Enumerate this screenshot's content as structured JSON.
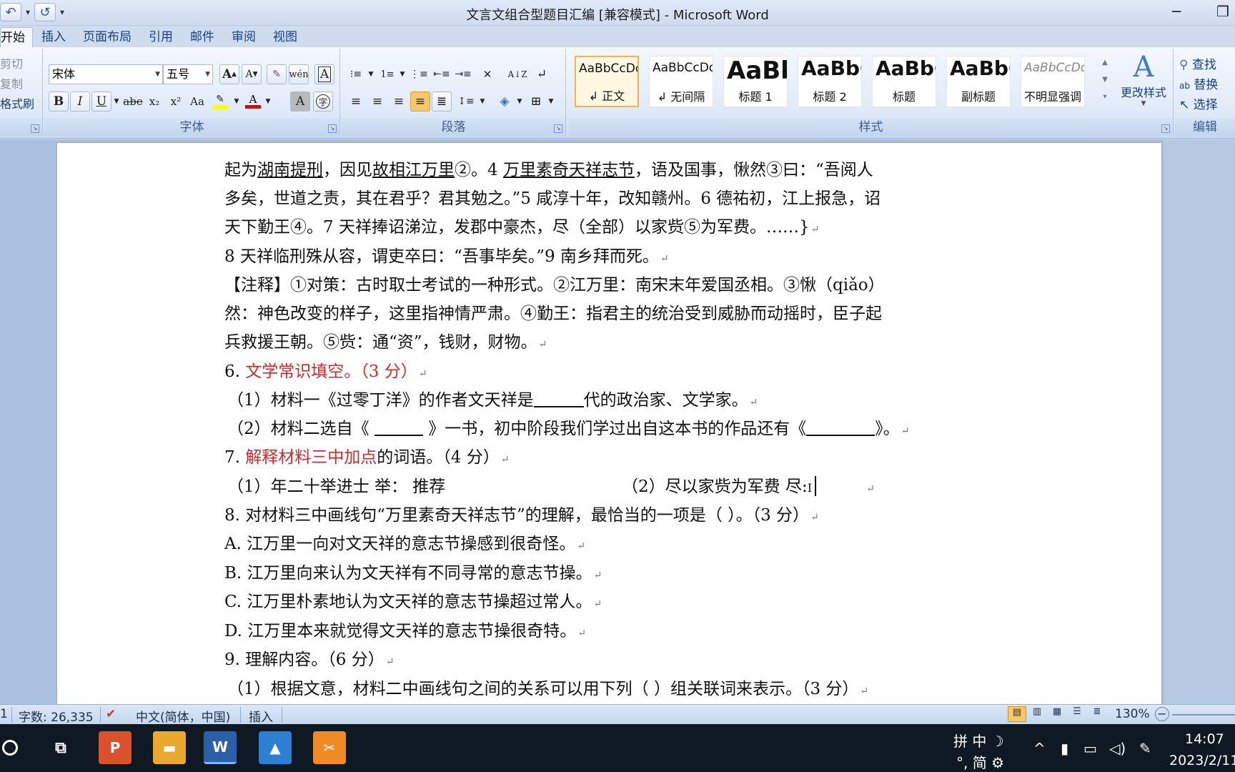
{
  "window": {
    "title": "文言文组合型题目汇编 [兼容模式] - Microsoft Word",
    "minimize": "─",
    "restore": "❐"
  },
  "qat": {
    "undo": "↶",
    "redo": "↺",
    "more": "▾"
  },
  "tabs": [
    "开始",
    "插入",
    "页面布局",
    "引用",
    "邮件",
    "审阅",
    "视图"
  ],
  "clipboard": {
    "cut": "剪切",
    "copy": "复制",
    "format_painter": "格式刷"
  },
  "font_group": {
    "label": "字体",
    "font_name": "宋体",
    "font_size": "五号",
    "bold": "B",
    "italic": "I",
    "underline": "U",
    "strike": "abe",
    "subscript": "x₂",
    "superscript": "x²",
    "change_case": "Aa",
    "grow": "A",
    "shrink": "A",
    "highlight_color": "#ffff00",
    "font_color": "#e00000"
  },
  "paragraph_group": {
    "label": "段落"
  },
  "styles_group": {
    "label": "样式",
    "styles": [
      {
        "sample": "AaBbCcDdI",
        "name": "↲ 正文",
        "size": 17,
        "bold": false
      },
      {
        "sample": "AaBbCcDdI",
        "name": "↲ 无间隔",
        "size": 17,
        "bold": false
      },
      {
        "sample": "AaBb",
        "name": "标题 1",
        "size": 34,
        "bold": true
      },
      {
        "sample": "AaBbC",
        "name": "标题 2",
        "size": 28,
        "bold": true
      },
      {
        "sample": "AaBbC",
        "name": "标题",
        "size": 28,
        "bold": true
      },
      {
        "sample": "AaBbC",
        "name": "副标题",
        "size": 28,
        "bold": true
      },
      {
        "sample": "AaBbCcDd",
        "name": "不明显强调",
        "size": 17,
        "bold": false
      }
    ],
    "change_styles": "更改样式"
  },
  "edit_group": {
    "label": "编辑",
    "find": "查找",
    "replace": "替换",
    "select": "选择"
  },
  "document": {
    "p1_a": "起为",
    "p1_u1": "湖南提刑",
    "p1_b": "，因见",
    "p1_u2": "故相江万里",
    "p1_c": "②。4",
    "p1_u3": "万里素奇天祥志节",
    "p1_d": "，语及国事，愀然③曰：“吾阅人",
    "p2": "多矣，世道之责，其在君乎？君其勉之。”5 咸淳十年，改知赣州。6 德祐初，江上报急，诏",
    "p3": "天下勤王④。7 天祥捧诏涕泣，发郡中豪杰，尽（全部）以家赀⑤为军费。……}",
    "p4": "8 天祥临刑殊从容，谓吏卒曰：“吾事毕矣。”9 南乡拜而死。",
    "p5": "【注释】①对策：古时取士考试的一种形式。②江万里：南宋末年爱国丞相。③愀（qiǎo）",
    "p6": "然：神色改变的样子，这里指神情严肃。④勤王：指君主的统治受到威胁而动摇时，臣子起",
    "p7": "兵救援王朝。⑤赀：通“资”，钱财，财物。",
    "q6_num": "6.",
    "q6_red": "文学常识填空。（3 分）",
    "q6_1a": "（1）材料一《过零丁洋》的作者文天祥是",
    "q6_1b": "代的政治家、文学家。",
    "q6_2a": "（2）材料二选自《",
    "q6_2b": "》一书，初中阶段我们学过出自这本书的作品还有《",
    "q6_2c": "》。",
    "q7_num": "7.",
    "q7_red": "解释材料三中加点",
    "q7_rest": "的词语。（4 分）",
    "q7_1": "（1）年二十举进士    举：  推荐",
    "q7_2": "（2）尽以家赀为军费    尽:",
    "q8": "8. 对材料三中画线句“万里素奇天祥志节”的理解，最恰当的一项是（      ）。（3 分）",
    "q8_a": "A.  江万里一向对文天祥的意志节操感到很奇怪。",
    "q8_b": "B.  江万里向来认为文天祥有不同寻常的意志节操。",
    "q8_c": "C.  江万里朴素地认为文天祥的意志节操超过常人。",
    "q8_d": "D.  江万里本来就觉得文天祥的意志节操很奇特。",
    "q9": "9.  理解内容。（6 分）",
    "q9_1": "（1）根据文意，材料二中画线句之间的关系可以用下列（        ）组关联词来表示。（3 分）",
    "pilcrow": "↵"
  },
  "status": {
    "page": "1",
    "word_count": "字数: 26,335",
    "language": "中文(简体，中国)",
    "mode": "插入",
    "zoom": "130%"
  },
  "taskbar": {
    "ime_top": "拼 中 ☽",
    "ime_bottom": "°, 简 ⚙",
    "time": "14:07",
    "date": "2023/2/11"
  }
}
